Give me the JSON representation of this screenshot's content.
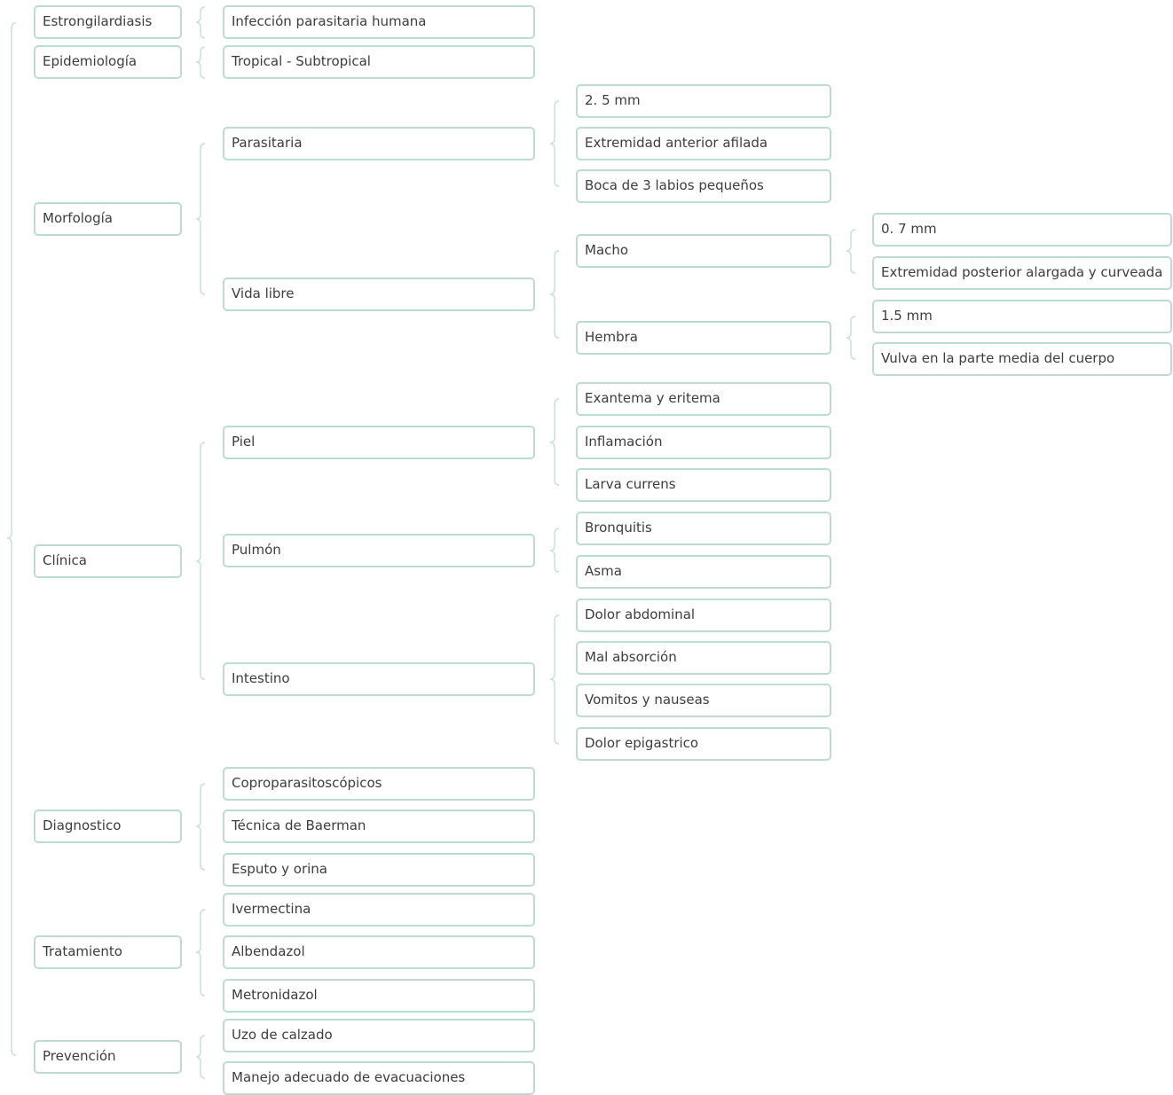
{
  "colors": {
    "connector": "#c8e2da",
    "node_border": "#bcdcd2",
    "text": "#3d3d3d"
  },
  "nodes": {
    "estrongilardiasis": "Estrongilardiasis",
    "infeccion": "Infección parasitaria humana",
    "epidemiologia": "Epidemiología",
    "tropical": "Tropical - Subtropical",
    "morfologia": "Morfología",
    "parasitaria": "Parasitaria",
    "p_25mm": "2. 5 mm",
    "p_extremidad": "Extremidad anterior afilada",
    "p_boca": "Boca de 3 labios pequeños",
    "vida_libre": "Vida libre",
    "macho": "Macho",
    "m_07mm": "0. 7 mm",
    "m_extremidad": "Extremidad posterior alargada y curveada",
    "hembra": "Hembra",
    "h_15mm": "1.5 mm",
    "h_vulva": "Vulva en la parte media del cuerpo",
    "clinica": "Clínica",
    "piel": "Piel",
    "exantema": "Exantema y eritema",
    "inflamacion": "Inflamación",
    "larva": "Larva currens",
    "pulmon": "Pulmón",
    "bronquitis": "Bronquitis",
    "asma": "Asma",
    "intestino": "Intestino",
    "dolor_abdominal": "Dolor abdominal",
    "mal_absorcion": "Mal absorción",
    "vomitos": "Vomitos y nauseas",
    "dolor_epigastrico": "Dolor epigastrico",
    "diagnostico": "Diagnostico",
    "coproparasito": "Coproparasitoscópicos",
    "baerman": "Técnica de Baerman",
    "esputo": "Esputo y orina",
    "tratamiento": "Tratamiento",
    "ivermectina": "Ivermectina",
    "albendazol": "Albendazol",
    "metronidazol": "Metronidazol",
    "prevencion": "Prevención",
    "calzado": "Uzo de calzado",
    "evacuaciones": "Manejo adecuado de evacuaciones"
  }
}
